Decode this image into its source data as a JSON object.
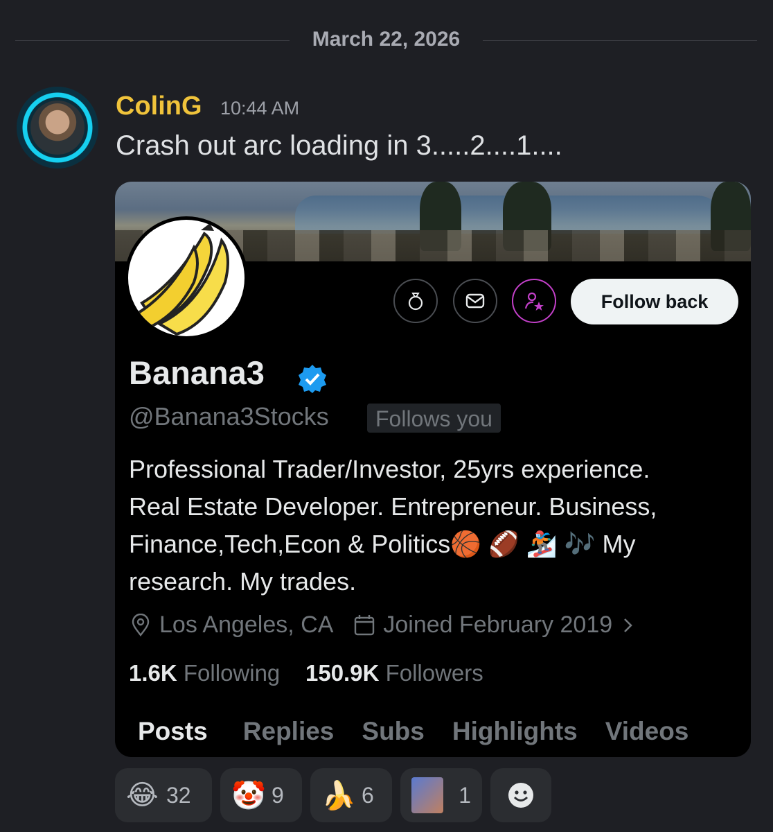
{
  "date_divider": "March 22, 2026",
  "message": {
    "author": "ColinG",
    "time": "10:44 AM",
    "text": "Crash out arc loading in 3.....2....1...."
  },
  "embed": {
    "display_name": "Banana3",
    "handle": "@Banana3Stocks",
    "follows_you": "Follows you",
    "follow_button": "Follow back",
    "bio_lines": [
      "Professional Trader/Investor, 25yrs experience.",
      "Real Estate Developer. Entrepreneur. Business,",
      "Finance,Tech,Econ & Politics🏀 🏈 🏂 🎶 My",
      "research. My trades."
    ],
    "location": "Los Angeles, CA",
    "joined": "Joined February 2019",
    "following_count": "1.6K",
    "following_label": "Following",
    "followers_count": "150.9K",
    "followers_label": "Followers",
    "tabs": [
      "Posts",
      "Replies",
      "Subs",
      "Highlights",
      "Videos"
    ],
    "icons": [
      "money-bag-icon",
      "mail-icon",
      "user-star-icon",
      "verified-badge-icon",
      "location-pin-icon",
      "calendar-icon",
      "chevron-right-icon"
    ]
  },
  "reactions": [
    {
      "emoji": "😂",
      "count": "32"
    },
    {
      "emoji": "🤡",
      "count": "9"
    },
    {
      "emoji": "🍌",
      "count": "6"
    },
    {
      "emoji": "",
      "count": "1"
    }
  ],
  "colors": {
    "background": "#1e1f24",
    "username": "#f0c33b",
    "card": "#000000",
    "verified": "#1d9bf0",
    "accent_ring": "#c340c9"
  }
}
